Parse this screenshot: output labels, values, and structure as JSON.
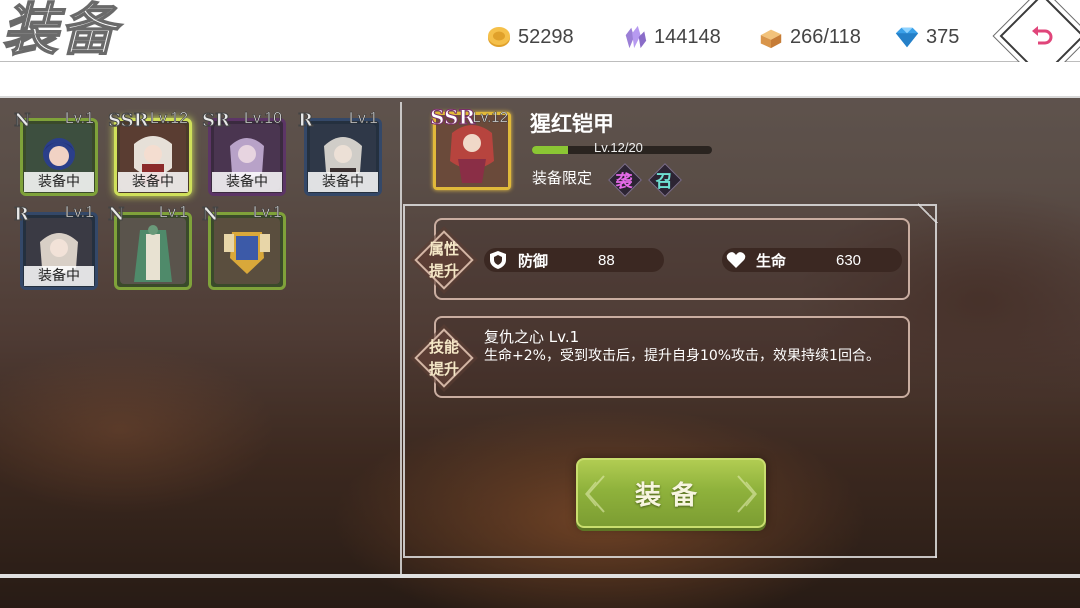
{
  "header": {
    "title": "装备",
    "resources": [
      {
        "icon": "gold-coin-icon",
        "value": "52298"
      },
      {
        "icon": "purple-crystal-icon",
        "value": "144148"
      },
      {
        "icon": "bread-stamina-icon",
        "value": "266/118"
      },
      {
        "icon": "diamond-gem-icon",
        "value": "375"
      }
    ]
  },
  "inventory": {
    "items": [
      {
        "rarity": "N",
        "level": "Lv.1",
        "status": "装备中",
        "frame": "green"
      },
      {
        "rarity": "SSR",
        "level": "Lv.12",
        "status": "装备中",
        "frame": "gold",
        "selected": true
      },
      {
        "rarity": "SR",
        "level": "Lv.10",
        "status": "装备中",
        "frame": "purple"
      },
      {
        "rarity": "R",
        "level": "Lv.1",
        "status": "装备中",
        "frame": "blue"
      },
      {
        "rarity": "R",
        "level": "Lv.1",
        "status": "装备中",
        "frame": "blue"
      },
      {
        "rarity": "N",
        "level": "Lv.1",
        "status": "",
        "frame": "green"
      },
      {
        "rarity": "N",
        "level": "Lv.1",
        "status": "",
        "frame": "green"
      }
    ]
  },
  "detail": {
    "rarity": "SSR",
    "level": "Lv.12",
    "name": "猩红铠甲",
    "xp_text": "Lv.12/20",
    "xp_fraction": 0.2,
    "limit_label": "装备限定",
    "limit_badges": [
      "袭",
      "召"
    ],
    "attr_tag_line1": "属性",
    "attr_tag_line2": "提升",
    "stats": [
      {
        "icon": "shield-icon",
        "label": "防御",
        "value": "88"
      },
      {
        "icon": "heart-icon",
        "label": "生命",
        "value": "630"
      }
    ],
    "skill_tag_line1": "技能",
    "skill_tag_line2": "提升",
    "skill_title": "复仇之心 Lv.1",
    "skill_desc": "生命+2%，受到攻击后，提升自身10%攻击，效果持续1回合。"
  },
  "actions": {
    "equip_label": "装备"
  },
  "colors": {
    "equip_button": "#8fb23c",
    "ssr_frame": "#e1b93a",
    "xp_fill": "#8bc634"
  }
}
